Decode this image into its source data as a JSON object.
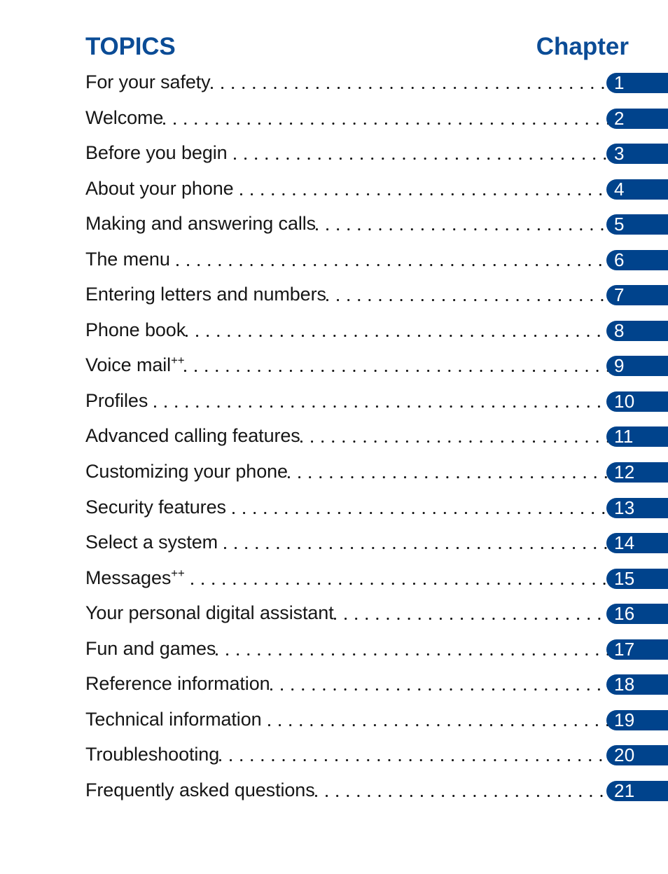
{
  "header": {
    "topics_label": "TOPICS",
    "chapter_label": "Chapter"
  },
  "colors": {
    "heading_blue": "#0B4C96",
    "badge_blue": "#00438C",
    "badge_text": "#FFFFFF",
    "body_text": "#161616",
    "page_background": "#FFFFFF"
  },
  "toc": {
    "entries": [
      {
        "title": "For your safety",
        "suffix": "",
        "leader_gap": false,
        "chapter": "1"
      },
      {
        "title": "Welcome",
        "suffix": "",
        "leader_gap": false,
        "chapter": "2"
      },
      {
        "title": "Before you begin",
        "suffix": "",
        "leader_gap": true,
        "chapter": "3"
      },
      {
        "title": "About your phone",
        "suffix": "",
        "leader_gap": true,
        "chapter": "4"
      },
      {
        "title": "Making and answering calls",
        "suffix": "",
        "leader_gap": false,
        "chapter": "5"
      },
      {
        "title": "The menu",
        "suffix": "",
        "leader_gap": true,
        "chapter": "6"
      },
      {
        "title": "Entering letters and numbers",
        "suffix": "",
        "leader_gap": false,
        "chapter": "7"
      },
      {
        "title": "Phone book",
        "suffix": "",
        "leader_gap": false,
        "chapter": "8"
      },
      {
        "title": "Voice mail",
        "suffix": "++",
        "leader_gap": false,
        "chapter": "9"
      },
      {
        "title": "Profiles",
        "suffix": "",
        "leader_gap": true,
        "chapter": "10"
      },
      {
        "title": "Advanced calling features",
        "suffix": "",
        "leader_gap": false,
        "chapter": "11"
      },
      {
        "title": "Customizing your phone",
        "suffix": "",
        "leader_gap": false,
        "chapter": "12"
      },
      {
        "title": "Security features",
        "suffix": "",
        "leader_gap": true,
        "chapter": "13"
      },
      {
        "title": "Select a system",
        "suffix": "",
        "leader_gap": true,
        "chapter": "14"
      },
      {
        "title": "Messages",
        "suffix": "++",
        "leader_gap": true,
        "chapter": "15"
      },
      {
        "title": "Your personal digital assistant",
        "suffix": "",
        "leader_gap": false,
        "chapter": "16"
      },
      {
        "title": "Fun and games",
        "suffix": "",
        "leader_gap": false,
        "chapter": "17"
      },
      {
        "title": "Reference information",
        "suffix": "",
        "leader_gap": false,
        "chapter": "18"
      },
      {
        "title": "Technical information",
        "suffix": "",
        "leader_gap": true,
        "chapter": "19"
      },
      {
        "title": "Troubleshooting",
        "suffix": "",
        "leader_gap": false,
        "chapter": "20"
      },
      {
        "title": "Frequently asked questions",
        "suffix": "",
        "leader_gap": false,
        "chapter": "21"
      }
    ]
  }
}
